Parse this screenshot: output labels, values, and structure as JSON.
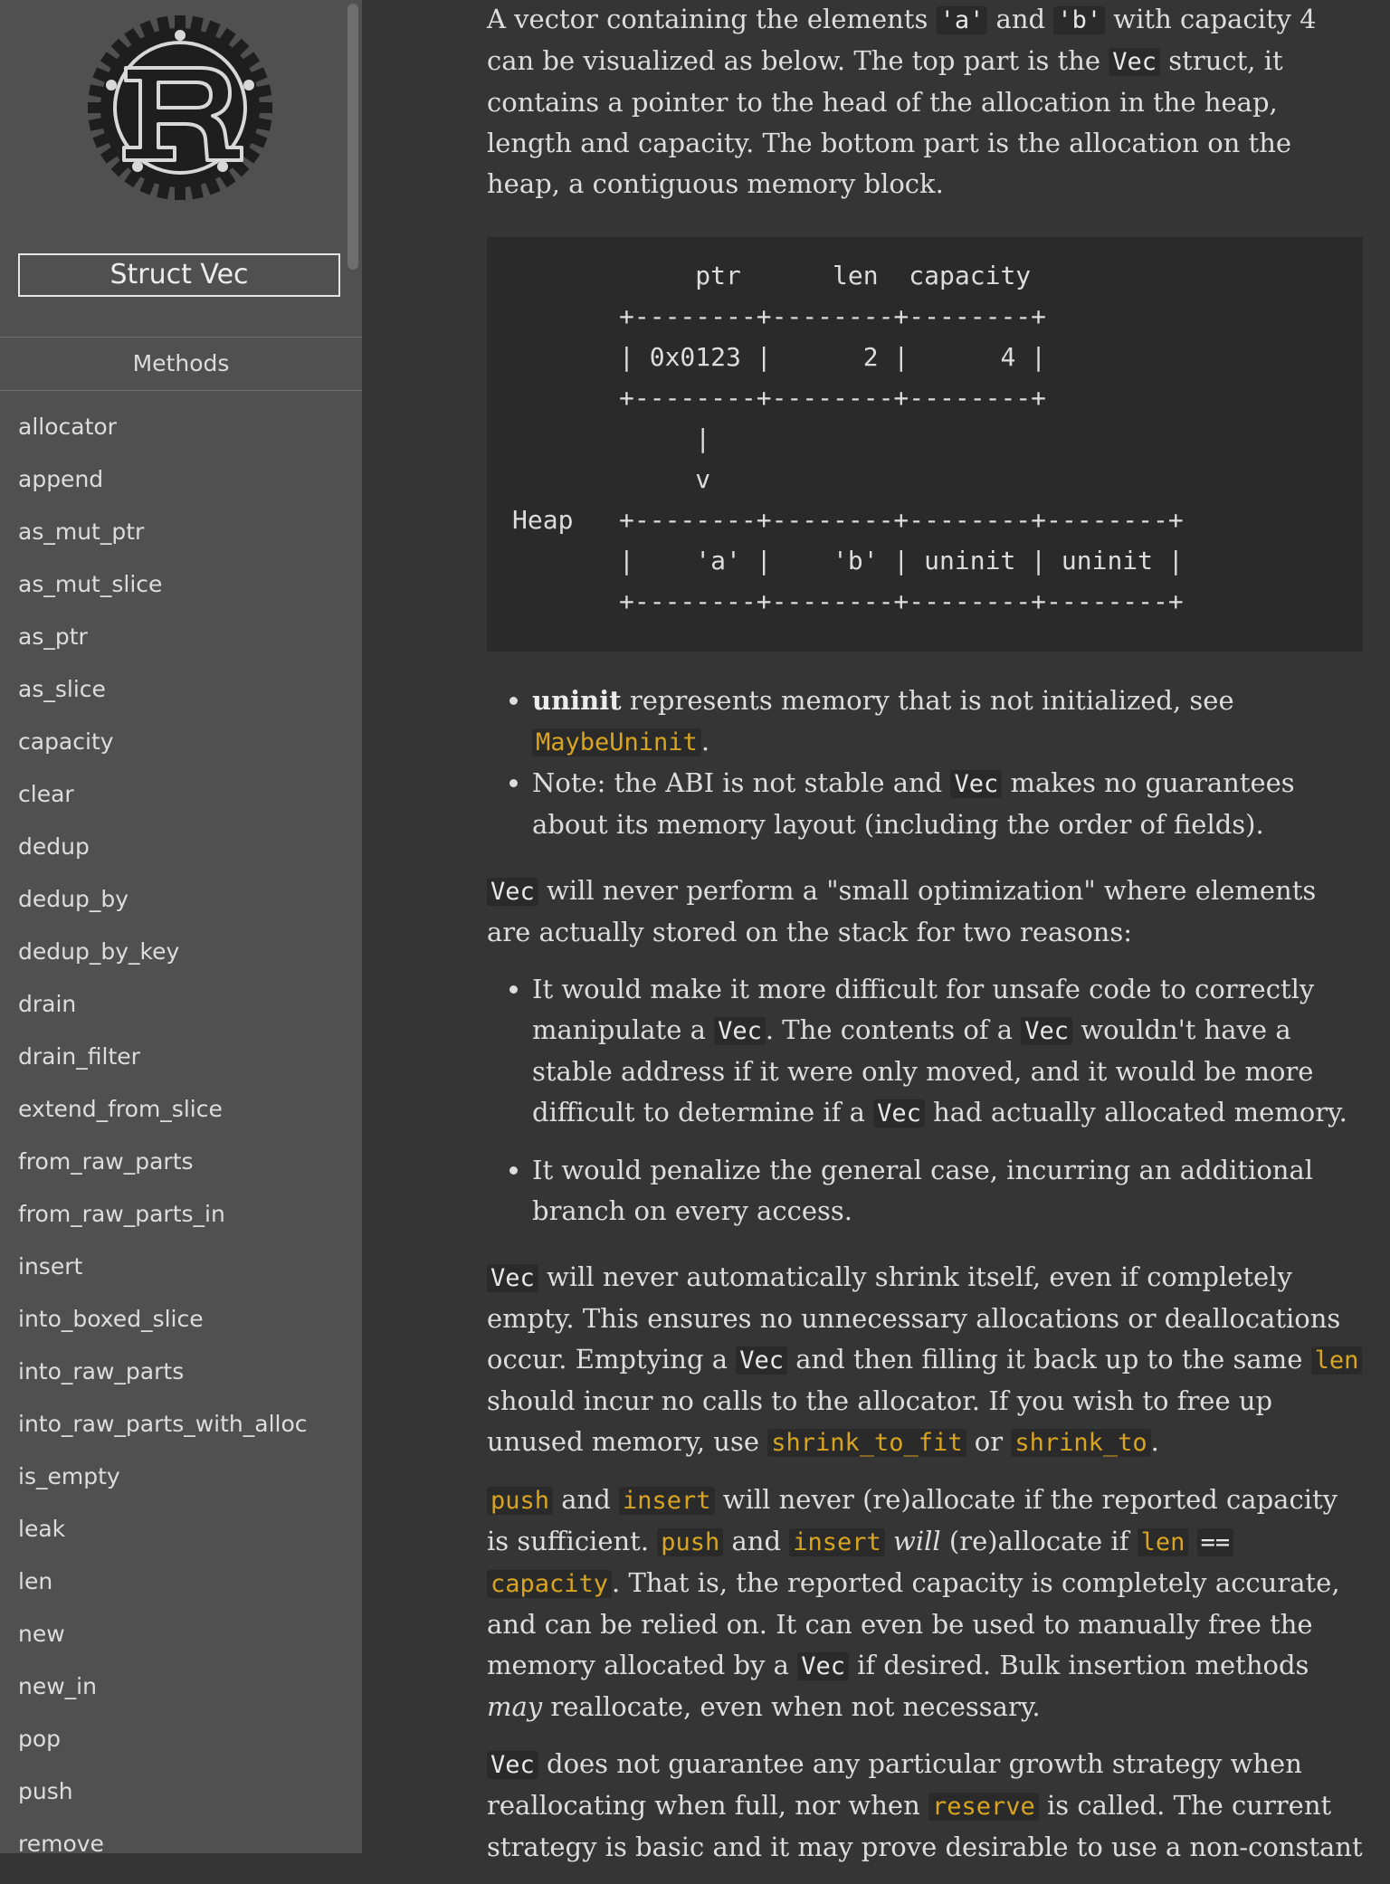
{
  "sidebar": {
    "logo_icon": "rust-logo-icon",
    "struct_title": "Struct Vec",
    "methods_header": "Methods",
    "methods": [
      "allocator",
      "append",
      "as_mut_ptr",
      "as_mut_slice",
      "as_ptr",
      "as_slice",
      "capacity",
      "clear",
      "dedup",
      "dedup_by",
      "dedup_by_key",
      "drain",
      "drain_filter",
      "extend_from_slice",
      "from_raw_parts",
      "from_raw_parts_in",
      "insert",
      "into_boxed_slice",
      "into_raw_parts",
      "into_raw_parts_with_alloc",
      "is_empty",
      "leak",
      "len",
      "new",
      "new_in",
      "pop",
      "push",
      "remove"
    ]
  },
  "content": {
    "p1": {
      "t1": "A vector containing the elements ",
      "c1": "'a'",
      "t2": " and ",
      "c2": "'b'",
      "t3": " with capacity 4 can be visualized as below. The top part is the ",
      "c3": "Vec",
      "t4": " struct, it contains a pointer to the head of the allocation in the heap, length and capacity. The bottom part is the allocation on the heap, a contiguous memory block."
    },
    "diagram": "            ptr      len  capacity\n       +--------+--------+--------+\n       | 0x0123 |      2 |      4 |\n       +--------+--------+--------+\n            |\n            v\nHeap   +--------+--------+--------+--------+\n       |    'a' |    'b' | uninit | uninit |\n       +--------+--------+--------+--------+",
    "list1": {
      "item1_bold": "uninit",
      "item1_text": " represents memory that is not initialized, see ",
      "item1_link": "MaybeUninit",
      "item1_end": ".",
      "item2_t1": "Note: the ABI is not stable and ",
      "item2_c1": "Vec",
      "item2_t2": " makes no guarantees about its memory layout (including the order of fields)."
    },
    "p2": {
      "c1": "Vec",
      "t1": " will never perform a \"small optimization\" where elements are actually stored on the stack for two reasons:"
    },
    "list2": {
      "item1_t1": "It would make it more difficult for unsafe code to correctly manipulate a ",
      "item1_c1": "Vec",
      "item1_t2": ". The contents of a ",
      "item1_c2": "Vec",
      "item1_t3": " wouldn't have a stable address if it were only moved, and it would be more difficult to determine if a ",
      "item1_c3": "Vec",
      "item1_t4": " had actually allocated memory.",
      "item2": "It would penalize the general case, incurring an additional branch on every access."
    },
    "p3": {
      "c1": "Vec",
      "t1": " will never automatically shrink itself, even if completely empty. This ensures no unnecessary allocations or deallocations occur. Emptying a ",
      "c2": "Vec",
      "t2": " and then filling it back up to the same ",
      "l1": "len",
      "t3": " should incur no calls to the allocator. If you wish to free up unused memory, use ",
      "l2": "shrink_to_fit",
      "t4": " or ",
      "l3": "shrink_to",
      "t5": "."
    },
    "p4": {
      "l1": "push",
      "t1": " and ",
      "l2": "insert",
      "t2": " will never (re)allocate if the reported capacity is sufficient. ",
      "l3": "push",
      "t3": " and ",
      "l4": "insert",
      "t4": " ",
      "em1": "will",
      "t5": " (re)allocate if ",
      "l5": "len",
      "t6": " ",
      "c1": "==",
      "t7": " ",
      "l6": "capacity",
      "t8": ". That is, the reported capacity is completely accurate, and can be relied on. It can even be used to manually free the memory allocated by a ",
      "c2": "Vec",
      "t9": " if desired. Bulk insertion methods ",
      "em2": "may",
      "t10": " reallocate, even when not necessary."
    },
    "p5": {
      "c1": "Vec",
      "t1": " does not guarantee any particular growth strategy when reallocating when full, nor when ",
      "l1": "reserve",
      "t2": " is called. The current strategy is basic and it may prove desirable to use a non-constant"
    }
  }
}
